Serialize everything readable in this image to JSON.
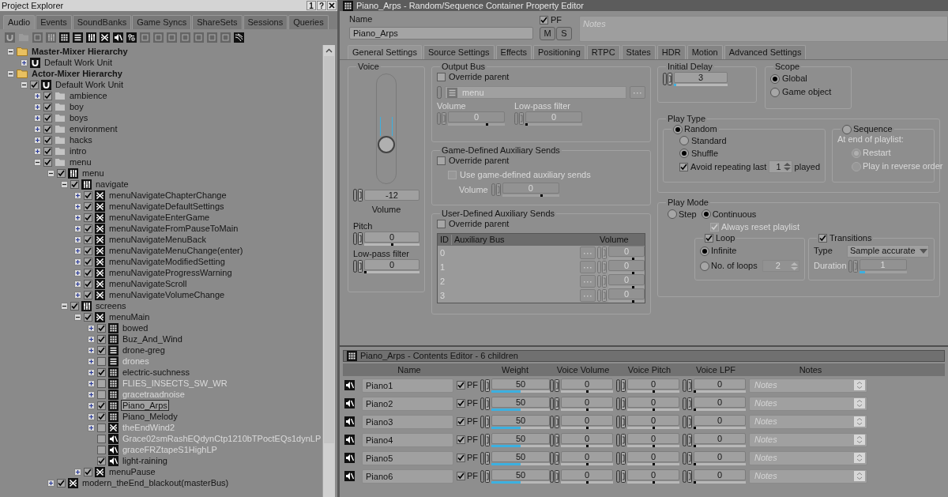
{
  "explorer": {
    "title": "Project Explorer",
    "window_buttons": [
      "1",
      "?"
    ],
    "tabs": [
      {
        "label": "Audio",
        "selected": true
      },
      {
        "label": "Events",
        "selected": false
      },
      {
        "label": "SoundBanks",
        "selected": false
      },
      {
        "label": "Game Syncs",
        "selected": false
      },
      {
        "label": "ShareSets",
        "selected": false
      },
      {
        "label": "Sessions",
        "selected": false
      },
      {
        "label": "Queries",
        "selected": false
      }
    ],
    "toolbar": [
      {
        "kind": "workunit",
        "disabled": true
      },
      {
        "kind": "folder",
        "disabled": true
      },
      {
        "kind": "square",
        "disabled": true
      },
      {
        "kind": "actormixer",
        "disabled": true
      },
      {
        "kind": "random",
        "disabled": false
      },
      {
        "kind": "sequence",
        "disabled": false
      },
      {
        "kind": "actormixer",
        "disabled": false
      },
      {
        "kind": "switch",
        "disabled": false
      },
      {
        "kind": "sound",
        "disabled": false
      },
      {
        "kind": "music",
        "disabled": false
      },
      {
        "kind": "square",
        "disabled": true
      },
      {
        "kind": "square",
        "disabled": true
      },
      {
        "kind": "square",
        "disabled": true
      },
      {
        "kind": "square",
        "disabled": true
      },
      {
        "kind": "square",
        "disabled": true
      },
      {
        "kind": "square",
        "disabled": true
      },
      {
        "kind": "square",
        "disabled": true
      },
      {
        "kind": "stripes",
        "disabled": false
      }
    ],
    "tree": [
      {
        "label": "Master-Mixer Hierarchy",
        "kind": "hierarchy",
        "expanded": true,
        "selected": false,
        "children": [
          {
            "label": "Default Work Unit",
            "kind": "workunit",
            "expanded": false,
            "selected": false
          }
        ]
      },
      {
        "label": "Actor-Mixer Hierarchy",
        "kind": "hierarchy",
        "expanded": true,
        "selected": false,
        "children": [
          {
            "label": "Default Work Unit",
            "kind": "workunit",
            "expanded": true,
            "checked": true,
            "selected": false,
            "children": [
              {
                "label": "ambience",
                "kind": "folder",
                "expanded": false,
                "checked": true,
                "selected": false
              },
              {
                "label": "boy",
                "kind": "folder",
                "expanded": false,
                "checked": true,
                "selected": false
              },
              {
                "label": "boys",
                "kind": "folder",
                "expanded": false,
                "checked": true,
                "selected": false
              },
              {
                "label": "environment",
                "kind": "folder",
                "expanded": false,
                "checked": true,
                "selected": false
              },
              {
                "label": "hacks",
                "kind": "folder",
                "expanded": false,
                "checked": true,
                "selected": false
              },
              {
                "label": "intro",
                "kind": "folder",
                "expanded": false,
                "checked": true,
                "selected": false
              },
              {
                "label": "menu",
                "kind": "folder",
                "expanded": true,
                "checked": true,
                "selected": false,
                "children": [
                  {
                    "label": "menu",
                    "kind": "actormixer",
                    "expanded": true,
                    "checked": true,
                    "selected": false,
                    "children": [
                      {
                        "label": "navigate",
                        "kind": "actormixer",
                        "expanded": true,
                        "checked": true,
                        "selected": false,
                        "children": [
                          {
                            "label": "menuNavigateChapterChange",
                            "kind": "switch",
                            "expanded": false,
                            "checked": true,
                            "selected": false
                          },
                          {
                            "label": "menuNavigateDefaultSettings",
                            "kind": "switch",
                            "expanded": false,
                            "checked": true,
                            "selected": false
                          },
                          {
                            "label": "menuNavigateEnterGame",
                            "kind": "switch",
                            "expanded": false,
                            "checked": true,
                            "selected": false
                          },
                          {
                            "label": "menuNavigateFromPauseToMain",
                            "kind": "switch",
                            "expanded": false,
                            "checked": true,
                            "selected": false
                          },
                          {
                            "label": "menuNavigateMenuBack",
                            "kind": "switch",
                            "expanded": false,
                            "checked": true,
                            "selected": false
                          },
                          {
                            "label": "menuNavigateMenuChange(enter)",
                            "kind": "switch",
                            "expanded": false,
                            "checked": true,
                            "selected": false
                          },
                          {
                            "label": "menuNavigateModifiedSetting",
                            "kind": "switch",
                            "expanded": false,
                            "checked": true,
                            "selected": false
                          },
                          {
                            "label": "menuNavigateProgressWarning",
                            "kind": "switch",
                            "expanded": false,
                            "checked": true,
                            "selected": false
                          },
                          {
                            "label": "menuNavigateScroll",
                            "kind": "switch",
                            "expanded": false,
                            "checked": true,
                            "selected": false
                          },
                          {
                            "label": "menuNavigateVolumeChange",
                            "kind": "switch",
                            "expanded": false,
                            "checked": true,
                            "selected": false
                          }
                        ]
                      },
                      {
                        "label": "screens",
                        "kind": "actormixer",
                        "expanded": true,
                        "checked": true,
                        "selected": false,
                        "children": [
                          {
                            "label": "menuMain",
                            "kind": "switch",
                            "expanded": true,
                            "checked": true,
                            "selected": false,
                            "children": [
                              {
                                "label": "bowed",
                                "kind": "random",
                                "expanded": false,
                                "checked": true,
                                "selected": false
                              },
                              {
                                "label": "Buz_And_Wind",
                                "kind": "random",
                                "expanded": false,
                                "checked": true,
                                "selected": false
                              },
                              {
                                "label": "drone-greg",
                                "kind": "sequence",
                                "expanded": false,
                                "checked": true,
                                "selected": false
                              },
                              {
                                "label": "drones",
                                "kind": "sequence",
                                "expanded": false,
                                "checked": false,
                                "selected": false
                              },
                              {
                                "label": "electric-suchness",
                                "kind": "random",
                                "expanded": false,
                                "checked": true,
                                "selected": false
                              },
                              {
                                "label": "FLIES_INSECTS_SW_WR",
                                "kind": "random",
                                "expanded": false,
                                "checked": false,
                                "selected": false
                              },
                              {
                                "label": "gracetraadnoise",
                                "kind": "random",
                                "expanded": false,
                                "checked": false,
                                "selected": false
                              },
                              {
                                "label": "Piano_Arps",
                                "kind": "random",
                                "expanded": false,
                                "checked": true,
                                "selected": true
                              },
                              {
                                "label": "Piano_Melody",
                                "kind": "random",
                                "expanded": false,
                                "checked": true,
                                "selected": false
                              },
                              {
                                "label": "theEndWind2",
                                "kind": "switch",
                                "expanded": false,
                                "checked": false,
                                "selected": false
                              },
                              {
                                "label": "Grace02smRashEQdynCtp1210bTPoctEQs1dynLP",
                                "kind": "sound",
                                "checked": false,
                                "selected": false
                              },
                              {
                                "label": "graceFRZtapeS1HighLP",
                                "kind": "sound",
                                "checked": false,
                                "selected": false
                              },
                              {
                                "label": "light-raining",
                                "kind": "sound",
                                "checked": true,
                                "selected": false
                              }
                            ]
                          },
                          {
                            "label": "menuPause",
                            "kind": "switch",
                            "expanded": false,
                            "checked": true,
                            "selected": false
                          }
                        ]
                      }
                    ]
                  },
                  {
                    "label": "modern_theEnd_blackout(masterBus)",
                    "kind": "switch",
                    "expanded": false,
                    "checked": true,
                    "selected": false
                  }
                ]
              }
            ]
          }
        ]
      }
    ]
  },
  "editor": {
    "title": "Piano_Arps - Random/Sequence Container Property Editor",
    "name_label": "Name",
    "name_value": "Piano_Arps",
    "pf": {
      "label": "PF",
      "checked": true
    },
    "buttons": [
      "M",
      "S"
    ],
    "notes": {
      "placeholder": "Notes"
    },
    "tabs": [
      {
        "label": "General Settings",
        "selected": true
      },
      {
        "label": "Source Settings",
        "selected": false
      },
      {
        "label": "Effects",
        "selected": false
      },
      {
        "label": "Positioning",
        "selected": false
      },
      {
        "label": "RTPC",
        "selected": false
      },
      {
        "label": "States",
        "selected": false
      },
      {
        "label": "HDR",
        "selected": false
      },
      {
        "label": "Motion",
        "selected": false
      },
      {
        "label": "Advanced Settings",
        "selected": false
      }
    ],
    "voice": {
      "title": "Voice",
      "level": 0.32,
      "volume_value": "-12",
      "volume_label": "Volume",
      "pitch": {
        "label": "Pitch",
        "value": "0",
        "level": 0.5
      },
      "lpf": {
        "label": "Low-pass filter",
        "value": "0",
        "level": 0
      }
    },
    "output_bus": {
      "title": "Output Bus",
      "override": {
        "label": "Override parent",
        "checked": false
      },
      "bus": "menu",
      "volume": {
        "label": "Volume",
        "value": "0",
        "level": 0.7
      },
      "lpf": {
        "label": "Low-pass filter",
        "value": "0",
        "level": 0
      }
    },
    "game_aux": {
      "title": "Game-Defined Auxiliary Sends",
      "override": {
        "label": "Override parent",
        "checked": false
      },
      "use_game": {
        "label": "Use game-defined auxiliary sends",
        "checked": false
      },
      "volume": {
        "label": "Volume",
        "value": "0",
        "level": 0.7
      }
    },
    "user_aux": {
      "title": "User-Defined Auxiliary Sends",
      "override": {
        "label": "Override parent",
        "checked": false
      },
      "columns": [
        "ID",
        "Auxiliary Bus",
        "Volume"
      ],
      "rows": [
        {
          "id": "0",
          "value": "0",
          "level": 0.7
        },
        {
          "id": "1",
          "value": "0",
          "level": 0.7
        },
        {
          "id": "2",
          "value": "0",
          "level": 0.7
        },
        {
          "id": "3",
          "value": "0",
          "level": 0.7
        }
      ]
    },
    "initial_delay": {
      "title": "Initial Delay",
      "value": "3",
      "level": 0.05
    },
    "scope": {
      "title": "Scope",
      "options": [
        {
          "label": "Global",
          "selected": true
        },
        {
          "label": "Game object",
          "selected": false
        }
      ]
    },
    "play_type": {
      "title": "Play Type",
      "random": {
        "label": "Random",
        "selected": true,
        "options": [
          {
            "label": "Standard",
            "selected": false
          },
          {
            "label": "Shuffle",
            "selected": true
          }
        ],
        "avoid": {
          "label": "Avoid repeating last",
          "checked": true,
          "value": "1",
          "suffix": "played"
        }
      },
      "sequence": {
        "label": "Sequence",
        "selected": false,
        "end_label": "At end of playlist:",
        "options": [
          {
            "label": "Restart",
            "selected": true
          },
          {
            "label": "Play in reverse order",
            "selected": false
          }
        ]
      }
    },
    "play_mode": {
      "title": "Play Mode",
      "modes": [
        {
          "label": "Step",
          "selected": false
        },
        {
          "label": "Continuous",
          "selected": true
        }
      ],
      "always_reset": {
        "label": "Always reset playlist",
        "checked": true,
        "disabled": true
      },
      "loop": {
        "label": "Loop",
        "checked": true,
        "options": [
          {
            "label": "Infinite",
            "selected": true
          },
          {
            "label": "No. of loops",
            "selected": false
          }
        ],
        "count": "2"
      },
      "transitions": {
        "label": "Transitions",
        "checked": true,
        "type_label": "Type",
        "type_value": "Sample accurate",
        "duration_label": "Duration",
        "duration": "1",
        "level": 0.12,
        "duration_disabled": true
      }
    }
  },
  "contents": {
    "title": "Piano_Arps - Contents Editor - 6 children",
    "columns": [
      "Name",
      "Weight",
      "Voice Volume",
      "Voice Pitch",
      "Voice LPF",
      "Notes"
    ],
    "rows": [
      {
        "name": "Piano1",
        "pf_label": "PF",
        "pf": true,
        "weight": {
          "value": "50",
          "level": 0.5
        },
        "volume": {
          "value": "0",
          "level": 0.5
        },
        "pitch": {
          "value": "0",
          "level": 0.5
        },
        "lpf": {
          "value": "0",
          "level": 0
        },
        "notes_placeholder": "Notes"
      },
      {
        "name": "Piano2",
        "pf_label": "PF",
        "pf": true,
        "weight": {
          "value": "50",
          "level": 0.5
        },
        "volume": {
          "value": "0",
          "level": 0.5
        },
        "pitch": {
          "value": "0",
          "level": 0.5
        },
        "lpf": {
          "value": "0",
          "level": 0
        },
        "notes_placeholder": "Notes"
      },
      {
        "name": "Piano3",
        "pf_label": "PF",
        "pf": true,
        "weight": {
          "value": "50",
          "level": 0.5
        },
        "volume": {
          "value": "0",
          "level": 0.5
        },
        "pitch": {
          "value": "0",
          "level": 0.5
        },
        "lpf": {
          "value": "0",
          "level": 0
        },
        "notes_placeholder": "Notes"
      },
      {
        "name": "Piano4",
        "pf_label": "PF",
        "pf": true,
        "weight": {
          "value": "50",
          "level": 0.5
        },
        "volume": {
          "value": "0",
          "level": 0.5
        },
        "pitch": {
          "value": "0",
          "level": 0.5
        },
        "lpf": {
          "value": "0",
          "level": 0
        },
        "notes_placeholder": "Notes"
      },
      {
        "name": "Piano5",
        "pf_label": "PF",
        "pf": true,
        "weight": {
          "value": "50",
          "level": 0.5
        },
        "volume": {
          "value": "0",
          "level": 0.5
        },
        "pitch": {
          "value": "0",
          "level": 0.5
        },
        "lpf": {
          "value": "0",
          "level": 0
        },
        "notes_placeholder": "Notes"
      },
      {
        "name": "Piano6",
        "pf_label": "PF",
        "pf": true,
        "weight": {
          "value": "50",
          "level": 0.5
        },
        "volume": {
          "value": "0",
          "level": 0.5
        },
        "pitch": {
          "value": "0",
          "level": 0.5
        },
        "lpf": {
          "value": "0",
          "level": 0
        },
        "notes_placeholder": "Notes"
      }
    ]
  }
}
